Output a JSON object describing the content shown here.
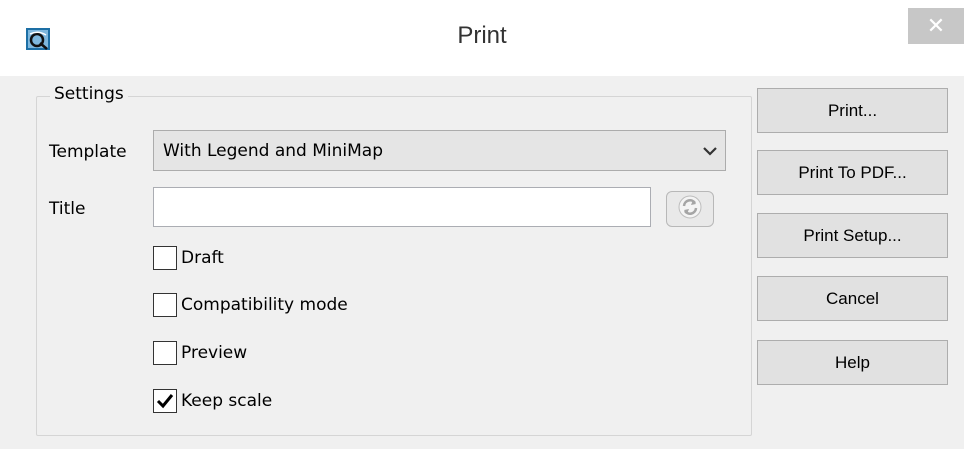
{
  "window": {
    "title": "Print",
    "close_glyph": "✕"
  },
  "settings": {
    "group_title": "Settings",
    "template": {
      "label": "Template",
      "selected": "With Legend and MiniMap"
    },
    "title_field": {
      "label": "Title",
      "value": "",
      "placeholder": ""
    },
    "checkboxes": [
      {
        "label": "Draft",
        "checked": false
      },
      {
        "label": "Compatibility mode",
        "checked": false
      },
      {
        "label": "Preview",
        "checked": false
      },
      {
        "label": "Keep scale",
        "checked": true
      }
    ]
  },
  "buttons": {
    "print": "Print...",
    "print_to_pdf": "Print To PDF...",
    "print_setup": "Print Setup...",
    "cancel": "Cancel",
    "help": "Help"
  },
  "icons": {
    "app": "map-app-icon",
    "refresh": "refresh-icon",
    "dropdown": "chevron-down-icon"
  },
  "colors": {
    "dialog_bg": "#f0f0f0",
    "titlebar_bg": "#ffffff",
    "close_bg": "#c7c7c7",
    "button_bg": "#e1e1e1"
  }
}
